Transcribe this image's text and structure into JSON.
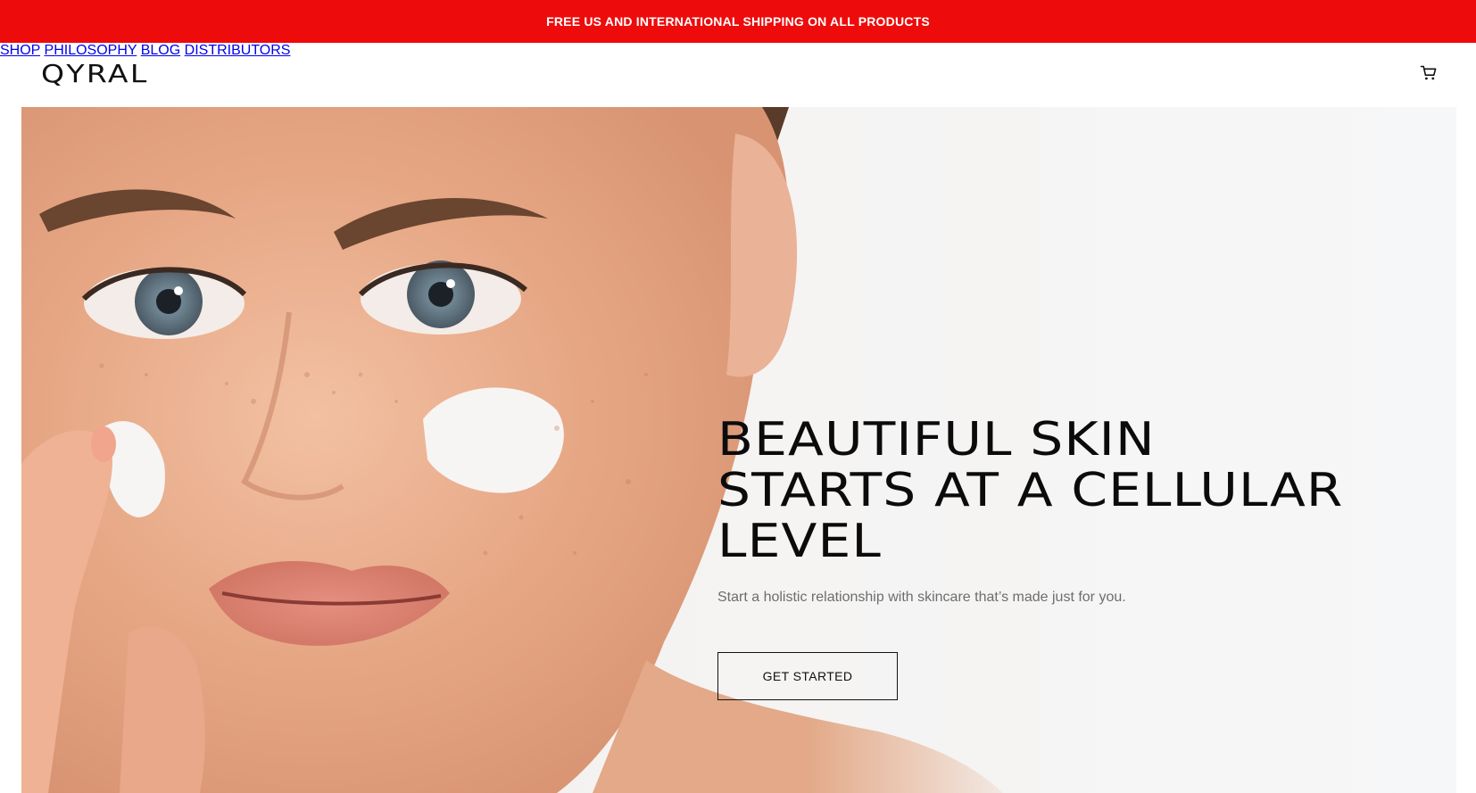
{
  "announcement": {
    "text": "FREE US AND INTERNATIONAL SHIPPING ON ALL PRODUCTS"
  },
  "header": {
    "logo": "QYRAL",
    "nav": [
      {
        "label": "SHOP"
      },
      {
        "label": "PHILOSOPHY"
      },
      {
        "label": "BLOG"
      },
      {
        "label": "DISTRIBUTORS"
      }
    ],
    "cart_icon": "cart-icon"
  },
  "hero": {
    "title_lines": [
      "BEAUTIFUL SKIN",
      "STARTS AT A CELLULAR",
      "LEVEL"
    ],
    "subtitle": "Start a holistic relationship with skincare that’s made just for you.",
    "cta_label": "GET STARTED",
    "image": "woman-applying-face-cream-photo"
  },
  "colors": {
    "announcement_bg": "#ee0b0b",
    "text": "#111111",
    "subtitle": "#6d6d6d",
    "hero_bg": "#f5f5f5"
  }
}
